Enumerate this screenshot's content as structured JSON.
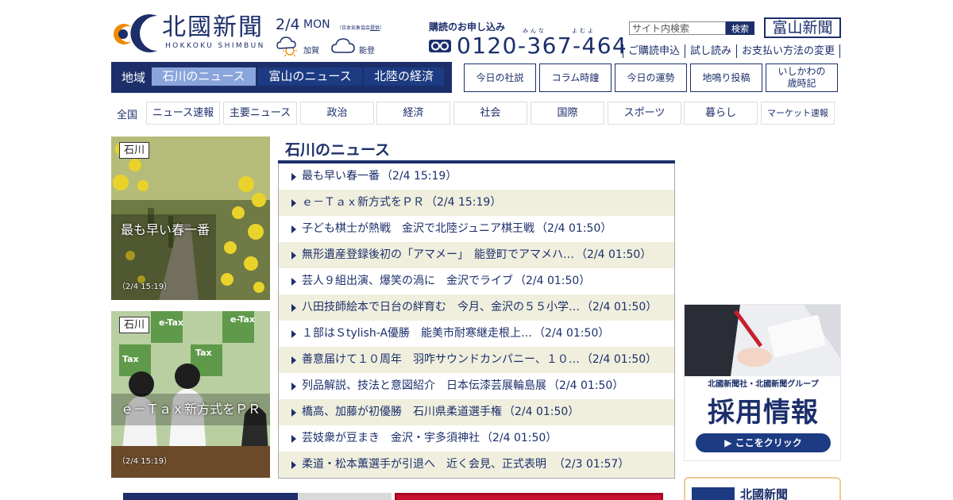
{
  "header": {
    "logo_title": "北國新聞",
    "logo_roman": "HOKKOKU SHIMBUN",
    "toyama_logo": "富山新聞"
  },
  "weather": {
    "date": "2/4",
    "day": "MON",
    "credit_prefix": "（日本気象協会",
    "credit_link": "提供",
    "credit_suffix": "）",
    "regions": [
      {
        "label": "加賀",
        "icon": "sun-cloud-icon"
      },
      {
        "label": "能登",
        "icon": "cloud-icon"
      }
    ]
  },
  "subscribe": {
    "title": "購読のお申し込み",
    "ruby_1": "みんな",
    "ruby_2": "よむよ",
    "phone": "0120-367-464"
  },
  "search": {
    "placeholder": "サイト内検索",
    "button": "検索"
  },
  "sublinks": [
    "ご購読申込",
    "試し読み",
    "お支払い方法の変更"
  ],
  "region_nav": {
    "label": "地域",
    "tabs": [
      {
        "label": "石川のニュース",
        "active": true
      },
      {
        "label": "富山のニュース",
        "active": false
      },
      {
        "label": "北陸の経済",
        "active": false
      }
    ]
  },
  "columns": [
    {
      "label": "今日の社説"
    },
    {
      "label": "コラム時鐘"
    },
    {
      "label": "今日の運勢"
    },
    {
      "label": "地鳴り投稿"
    },
    {
      "label": "いしかわの\n歳時記"
    }
  ],
  "categories": {
    "all": "全国",
    "items": [
      "ニュース速報",
      "主要ニュース",
      "政治",
      "経済",
      "社会",
      "国際",
      "スポーツ",
      "暮らし",
      "マーケット速報"
    ]
  },
  "features": [
    {
      "pref": "石川",
      "headline": "最も早い春一番",
      "time": "（2/4 15:19）"
    },
    {
      "pref": "石川",
      "headline": "ｅ－Ｔａｘ新方式をＰＲ",
      "time": "（2/4 15:19）"
    }
  ],
  "news": {
    "heading": "石川のニュース",
    "items": [
      {
        "title": "最も早い春一番",
        "time": "（2/4 15:19）"
      },
      {
        "title": "ｅ－Ｔａｘ新方式をＰＲ",
        "time": "（2/4 15:19）"
      },
      {
        "title": "子ども棋士が熱戦　金沢で北陸ジュニア棋王戦",
        "time": "（2/4 01:50）"
      },
      {
        "title": "無形遺産登録後初の「アマメー」　能登町でアマメハ…",
        "time": "（2/4 01:50）"
      },
      {
        "title": "芸人９組出演、爆笑の渦に　金沢でライブ",
        "time": "（2/4 01:50）"
      },
      {
        "title": "八田技師絵本で日台の絆育む　今月、金沢の５５小学…",
        "time": "（2/4 01:50）"
      },
      {
        "title": "１部はＳtylish-A優勝　能美市耐寒継走根上…",
        "time": "（2/4 01:50）"
      },
      {
        "title": "善意届けて１０周年　羽咋サウンドカンパニー、１０…",
        "time": "（2/4 01:50）"
      },
      {
        "title": "列品解説、技法と意図紹介　日本伝漆芸展輪島展",
        "time": "（2/4 01:50）"
      },
      {
        "title": "橋高、加藤が初優勝　石川県柔道選手権",
        "time": "（2/4 01:50）"
      },
      {
        "title": "芸妓衆が豆まき　金沢・宇多須神社",
        "time": "（2/4 01:50）"
      },
      {
        "title": "柔道・松本薫選手が引退へ　近く会見、正式表明　",
        "time": "（2/3 01:57）"
      }
    ]
  },
  "ad": {
    "sub": "北國新聞社・北國新聞グループ",
    "main": "採用情報",
    "button": "▶ ここをクリック"
  },
  "group_box": {
    "name": "北國新聞"
  },
  "colors": {
    "brand_navy": "#1c2f6b",
    "active_tab": "#8aa5db",
    "stripe": "#f0efde",
    "logo_orange": "#f08a00"
  }
}
